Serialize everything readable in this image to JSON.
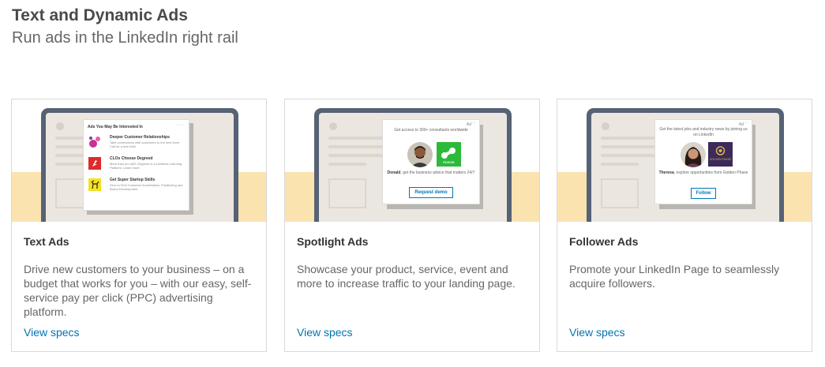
{
  "header": {
    "title": "Text and Dynamic Ads",
    "subtitle": "Run ads in the LinkedIn right rail"
  },
  "colors": {
    "accent": "#0073b1",
    "band": "#fbe3b0",
    "monitor": "#566275"
  },
  "cards": [
    {
      "title": "Text Ads",
      "description": "Drive new customers to your business – on a budget that works for you – with our easy, self-service pay per click (PPC) advertising platform.",
      "link": "View specs",
      "preview": {
        "heading": "Ads You May Be Interested In",
        "more": "···",
        "ads": [
          {
            "icon": "pink-circles-logo",
            "title": "Deeper Customer Relationships",
            "desc": "Take connections with customers to the next level. Call for a free trial!"
          },
          {
            "icon": "red-degreed-logo",
            "title": "CLOs Choose Degreed",
            "desc": "More than an LMS, Degreed is a Limitless Learning Platform. Learn more."
          },
          {
            "icon": "yellow-deer-logo",
            "title": "Get Super Startup Skills",
            "desc": "Zero to First Customer Acceleration, Positioning and Brand Development"
          }
        ]
      }
    },
    {
      "title": "Spotlight Ads",
      "description": "Showcase your product, service, event and more to increase traffic to your landing page.",
      "link": "View specs",
      "preview": {
        "ad_label": "Ad",
        "more": "···",
        "top_text": "Get access to 300+ consultants worldwide",
        "logo_text": "FLEXIS",
        "body_name": "Donald",
        "body_text": ", get the business advice that matters 24/7",
        "button": "Request demo"
      }
    },
    {
      "title": "Follower Ads",
      "description": "Promote your LinkedIn Page to seamlessly acquire followers.",
      "link": "View specs",
      "preview": {
        "ad_label": "Ad",
        "more": "···",
        "top_text": "Get the latest jobs and industry news by joining us on LinkedIn",
        "logo_text": "GOLDEN PHASE",
        "body_name": "Theresa",
        "body_text": ", explore opportunities from Golden Phase",
        "button": "Follow"
      }
    }
  ]
}
